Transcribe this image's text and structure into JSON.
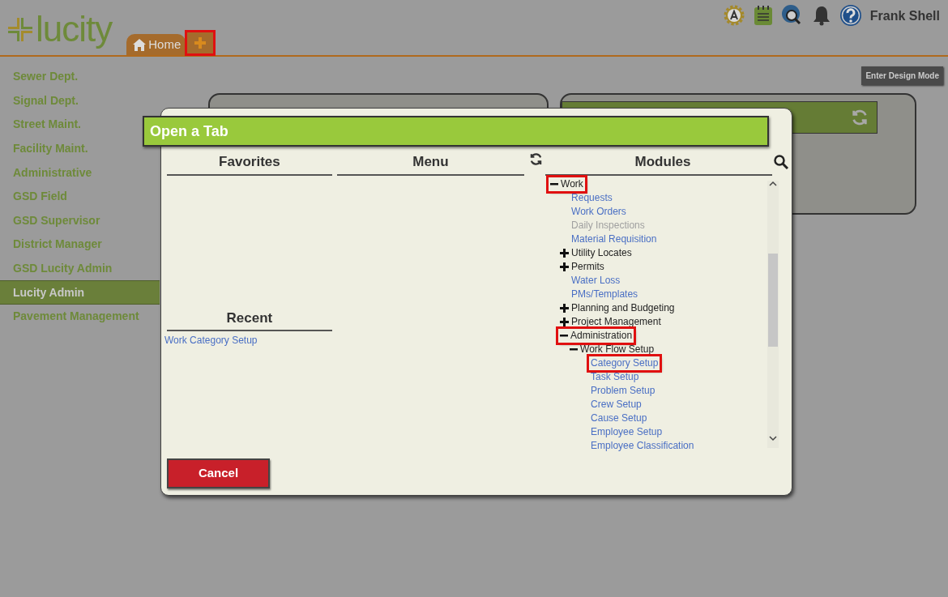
{
  "header": {
    "logo": "lucity",
    "tabs": [
      {
        "kind": "home",
        "label": "Home",
        "highlighted": false
      },
      {
        "kind": "add",
        "highlighted": true
      }
    ],
    "user": "Frank Shell"
  },
  "design_mode_button": "Enter Design Mode",
  "sidebar": {
    "items": [
      {
        "label": "Sewer Dept.",
        "selected": false
      },
      {
        "label": "Signal Dept.",
        "selected": false
      },
      {
        "label": "Street Maint.",
        "selected": false
      },
      {
        "label": "Facility Maint.",
        "selected": false
      },
      {
        "label": "Administrative",
        "selected": false
      },
      {
        "label": "GSD Field",
        "selected": false
      },
      {
        "label": "GSD Supervisor",
        "selected": false
      },
      {
        "label": "District Manager",
        "selected": false
      },
      {
        "label": "GSD Lucity Admin",
        "selected": false
      },
      {
        "label": "Lucity Admin",
        "selected": true
      },
      {
        "label": "Pavement Management",
        "selected": false
      }
    ]
  },
  "dialog": {
    "title": "Open a Tab",
    "favorites": {
      "heading": "Favorites"
    },
    "recent": {
      "heading": "Recent",
      "items": [
        "Work Category Setup"
      ]
    },
    "menu": {
      "heading": "Menu"
    },
    "modules": {
      "heading": "Modules",
      "tree": [
        {
          "label": "Work",
          "kind": "folder",
          "expanded": true,
          "highlighted": true,
          "children": [
            {
              "label": "Requests",
              "kind": "link",
              "disabled": false,
              "highlighted": false
            },
            {
              "label": "Work Orders",
              "kind": "link",
              "disabled": false,
              "highlighted": false
            },
            {
              "label": "Daily Inspections",
              "kind": "link",
              "disabled": true,
              "highlighted": false
            },
            {
              "label": "Material Requisition",
              "kind": "link",
              "disabled": false,
              "highlighted": false
            },
            {
              "label": "Utility Locates",
              "kind": "folder",
              "expanded": false,
              "highlighted": false
            },
            {
              "label": "Permits",
              "kind": "folder",
              "expanded": false,
              "highlighted": false
            },
            {
              "label": "Water Loss",
              "kind": "link",
              "disabled": false,
              "highlighted": false
            },
            {
              "label": "PMs/Templates",
              "kind": "link",
              "disabled": false,
              "highlighted": false
            },
            {
              "label": "Planning and Budgeting",
              "kind": "folder",
              "expanded": false,
              "highlighted": false
            },
            {
              "label": "Project Management",
              "kind": "folder",
              "expanded": false,
              "highlighted": false
            },
            {
              "label": "Administration",
              "kind": "folder",
              "expanded": true,
              "highlighted": true,
              "children": [
                {
                  "label": "Work Flow Setup",
                  "kind": "folder",
                  "expanded": true,
                  "highlighted": false,
                  "children": [
                    {
                      "label": "Category Setup",
                      "kind": "link",
                      "disabled": false,
                      "highlighted": true
                    },
                    {
                      "label": "Task Setup",
                      "kind": "link",
                      "disabled": false,
                      "highlighted": false
                    },
                    {
                      "label": "Problem Setup",
                      "kind": "link",
                      "disabled": false,
                      "highlighted": false
                    },
                    {
                      "label": "Crew Setup",
                      "kind": "link",
                      "disabled": false,
                      "highlighted": false
                    },
                    {
                      "label": "Cause Setup",
                      "kind": "link",
                      "disabled": false,
                      "highlighted": false
                    },
                    {
                      "label": "Employee Setup",
                      "kind": "link",
                      "disabled": false,
                      "highlighted": false
                    },
                    {
                      "label": "Employee Classification",
                      "kind": "link",
                      "disabled": false,
                      "highlighted": false
                    }
                  ]
                }
              ]
            }
          ]
        }
      ]
    },
    "cancel_button": "Cancel"
  }
}
